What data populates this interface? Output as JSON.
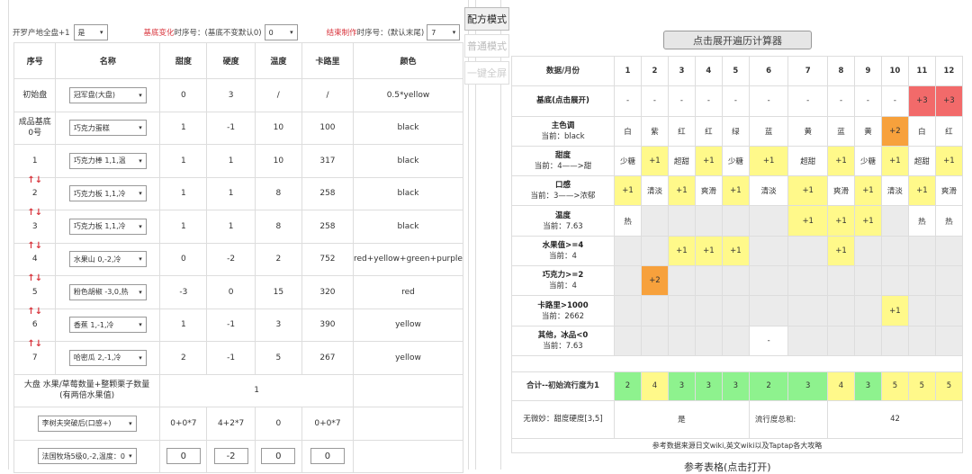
{
  "top": {
    "label1": "开罗产地全盘+1",
    "sel1": "是",
    "label2_red": "基底变化",
    "label2": "时序号：(基底不变默认0)",
    "sel2": "0",
    "label3_red": "结束制作",
    "label3": "时序号：(默认末尾)",
    "sel3": "7"
  },
  "mode_buttons": [
    "配方模式",
    "普通模式",
    "一键全屏"
  ],
  "left_table": {
    "headers": [
      "序号",
      "名称",
      "甜度",
      "硬度",
      "温度",
      "卡路里",
      "颜色"
    ],
    "rows": [
      {
        "seq": "初始盘",
        "name": "冠军盘(大盘)",
        "sweet": "0",
        "hard": "3",
        "temp": "/",
        "cal": "/",
        "color": "0.5*yellow",
        "arrow": ""
      },
      {
        "seq": "成品基底0号",
        "name": "巧克力蛋糕",
        "sweet": "1",
        "hard": "-1",
        "temp": "10",
        "cal": "100",
        "color": "black",
        "arrow": ""
      },
      {
        "seq": "1",
        "name": "巧克力棒  1,1,温",
        "sweet": "1",
        "hard": "1",
        "temp": "10",
        "cal": "317",
        "color": "black",
        "arrow": "↑↓"
      },
      {
        "seq": "2",
        "name": "巧克力板  1,1,冷",
        "sweet": "1",
        "hard": "1",
        "temp": "8",
        "cal": "258",
        "color": "black",
        "arrow": "↑↓"
      },
      {
        "seq": "3",
        "name": "巧克力板  1,1,冷",
        "sweet": "1",
        "hard": "1",
        "temp": "8",
        "cal": "258",
        "color": "black",
        "arrow": "↑↓"
      },
      {
        "seq": "4",
        "name": "水果山  0,-2,冷",
        "sweet": "0",
        "hard": "-2",
        "temp": "2",
        "cal": "752",
        "color": "red+yellow+green+purple",
        "arrow": "↑↓"
      },
      {
        "seq": "5",
        "name": "粉色胡椒  -3,0,热",
        "sweet": "-3",
        "hard": "0",
        "temp": "15",
        "cal": "320",
        "color": "red",
        "arrow": "↑↓"
      },
      {
        "seq": "6",
        "name": "香蕉  1,-1,冷",
        "sweet": "1",
        "hard": "-1",
        "temp": "3",
        "cal": "390",
        "color": "yellow",
        "arrow": "↑↓"
      },
      {
        "seq": "7",
        "name": "哈密瓜  2,-1,冷",
        "sweet": "2",
        "hard": "-1",
        "temp": "5",
        "cal": "267",
        "color": "yellow",
        "arrow": ""
      }
    ],
    "plate_label": "大盘 水果/草莓数量+整颗栗子数量\n(有两倍水果值)",
    "plate_value": "1",
    "extra_select": "李树夫突破后(口感+)",
    "extra_vals": [
      "0+0*7",
      "4+2*7",
      "0",
      "0+0*7"
    ],
    "ranch_select": "法国牧场5级0,-2,温度：0",
    "ranch_inputs": [
      "0",
      "-2",
      "0",
      "0"
    ]
  },
  "calc_button": "点击展开遍历计算器",
  "right_table": {
    "header": [
      "数据/月份",
      "1",
      "2",
      "3",
      "4",
      "5",
      "6",
      "7",
      "8",
      "9",
      "10",
      "11",
      "12"
    ],
    "rows": [
      {
        "title": "基底(点击展开)",
        "sub": "",
        "cells": [
          [
            "-",
            "w"
          ],
          [
            "-",
            "w"
          ],
          [
            "-",
            "w"
          ],
          [
            "-",
            "w"
          ],
          [
            "-",
            "w"
          ],
          [
            "-",
            "w"
          ],
          [
            "-",
            "w"
          ],
          [
            "-",
            "w"
          ],
          [
            "-",
            "w"
          ],
          [
            "-",
            "w"
          ],
          [
            "+3",
            "r"
          ],
          [
            "+3",
            "r"
          ]
        ]
      },
      {
        "title": "主色调",
        "sub": "当前：black",
        "cells": [
          [
            "白",
            "w"
          ],
          [
            "紫",
            "w"
          ],
          [
            "红",
            "w"
          ],
          [
            "红",
            "w"
          ],
          [
            "绿",
            "w"
          ],
          [
            "蓝",
            "w"
          ],
          [
            "黄",
            "w"
          ],
          [
            "蓝",
            "w"
          ],
          [
            "黄",
            "w"
          ],
          [
            "+2",
            "o"
          ],
          [
            "白",
            "w"
          ],
          [
            "红",
            "w"
          ]
        ]
      },
      {
        "title": "甜度",
        "sub": "当前：4——>甜",
        "cells": [
          [
            "少糖",
            "w"
          ],
          [
            "+1",
            "y"
          ],
          [
            "超甜",
            "w"
          ],
          [
            "+1",
            "y"
          ],
          [
            "少糖",
            "w"
          ],
          [
            "+1",
            "y"
          ],
          [
            "超甜",
            "w"
          ],
          [
            "+1",
            "y"
          ],
          [
            "少糖",
            "w"
          ],
          [
            "+1",
            "y"
          ],
          [
            "超甜",
            "w"
          ],
          [
            "+1",
            "y"
          ]
        ]
      },
      {
        "title": "口感",
        "sub": "当前：3——>浓郁",
        "cells": [
          [
            "+1",
            "y"
          ],
          [
            "清淡",
            "w"
          ],
          [
            "+1",
            "y"
          ],
          [
            "爽滑",
            "w"
          ],
          [
            "+1",
            "y"
          ],
          [
            "清淡",
            "w"
          ],
          [
            "+1",
            "y"
          ],
          [
            "爽滑",
            "w"
          ],
          [
            "+1",
            "y"
          ],
          [
            "清淡",
            "w"
          ],
          [
            "+1",
            "y"
          ],
          [
            "爽滑",
            "w"
          ]
        ]
      },
      {
        "title": "温度",
        "sub": "当前：7.63",
        "cells": [
          [
            "热",
            "w"
          ],
          [
            "",
            "g"
          ],
          [
            "",
            "g"
          ],
          [
            "",
            "g"
          ],
          [
            "",
            "g"
          ],
          [
            "",
            "g"
          ],
          [
            "+1",
            "y"
          ],
          [
            "+1",
            "y"
          ],
          [
            "+1",
            "y"
          ],
          [
            "",
            "g"
          ],
          [
            "热",
            "w"
          ],
          [
            "热",
            "w"
          ]
        ]
      },
      {
        "title": "水果值>=4",
        "sub": "当前：4",
        "cells": [
          [
            "",
            "g"
          ],
          [
            "",
            "g"
          ],
          [
            "+1",
            "y"
          ],
          [
            "+1",
            "y"
          ],
          [
            "+1",
            "y"
          ],
          [
            "",
            "g"
          ],
          [
            "",
            "g"
          ],
          [
            "+1",
            "y"
          ],
          [
            "",
            "g"
          ],
          [
            "",
            "g"
          ],
          [
            "",
            "g"
          ],
          [
            "",
            "g"
          ]
        ]
      },
      {
        "title": "巧克力>=2",
        "sub": "当前：4",
        "cells": [
          [
            "",
            "g"
          ],
          [
            "+2",
            "o"
          ],
          [
            "",
            "g"
          ],
          [
            "",
            "g"
          ],
          [
            "",
            "g"
          ],
          [
            "",
            "g"
          ],
          [
            "",
            "g"
          ],
          [
            "",
            "g"
          ],
          [
            "",
            "g"
          ],
          [
            "",
            "g"
          ],
          [
            "",
            "g"
          ],
          [
            "",
            "g"
          ]
        ]
      },
      {
        "title": "卡路里>1000",
        "sub": "当前：2662",
        "cells": [
          [
            "",
            "g"
          ],
          [
            "",
            "g"
          ],
          [
            "",
            "g"
          ],
          [
            "",
            "g"
          ],
          [
            "",
            "g"
          ],
          [
            "",
            "g"
          ],
          [
            "",
            "g"
          ],
          [
            "",
            "g"
          ],
          [
            "",
            "g"
          ],
          [
            "+1",
            "y"
          ],
          [
            "",
            "g"
          ],
          [
            "",
            "g"
          ]
        ]
      },
      {
        "title": "其他，冰品<0",
        "sub": "当前：7.63",
        "cells": [
          [
            "",
            "g"
          ],
          [
            "",
            "g"
          ],
          [
            "",
            "g"
          ],
          [
            "",
            "g"
          ],
          [
            "",
            "g"
          ],
          [
            "-",
            "w"
          ],
          [
            "",
            "g"
          ],
          [
            "",
            "g"
          ],
          [
            "",
            "g"
          ],
          [
            "",
            "g"
          ],
          [
            "",
            "g"
          ],
          [
            "",
            "g"
          ]
        ]
      }
    ],
    "total": {
      "title": "合计--初始流行度为1",
      "cells": [
        [
          "2",
          "G"
        ],
        [
          "4",
          "y"
        ],
        [
          "3",
          "G"
        ],
        [
          "3",
          "G"
        ],
        [
          "3",
          "G"
        ],
        [
          "2",
          "G"
        ],
        [
          "3",
          "G"
        ],
        [
          "4",
          "y"
        ],
        [
          "3",
          "G"
        ],
        [
          "5",
          "y"
        ],
        [
          "5",
          "y"
        ],
        [
          "5",
          "y"
        ]
      ]
    },
    "result": {
      "label": "无微妙：甜度硬度[3,5]",
      "value": "是",
      "sum_label": "流行度总和:",
      "sum": "42"
    },
    "footer": "参考数据来源日文wiki,英文wiki以及Taptap各大攻略"
  },
  "reference_link": "参考表格(点击打开)"
}
